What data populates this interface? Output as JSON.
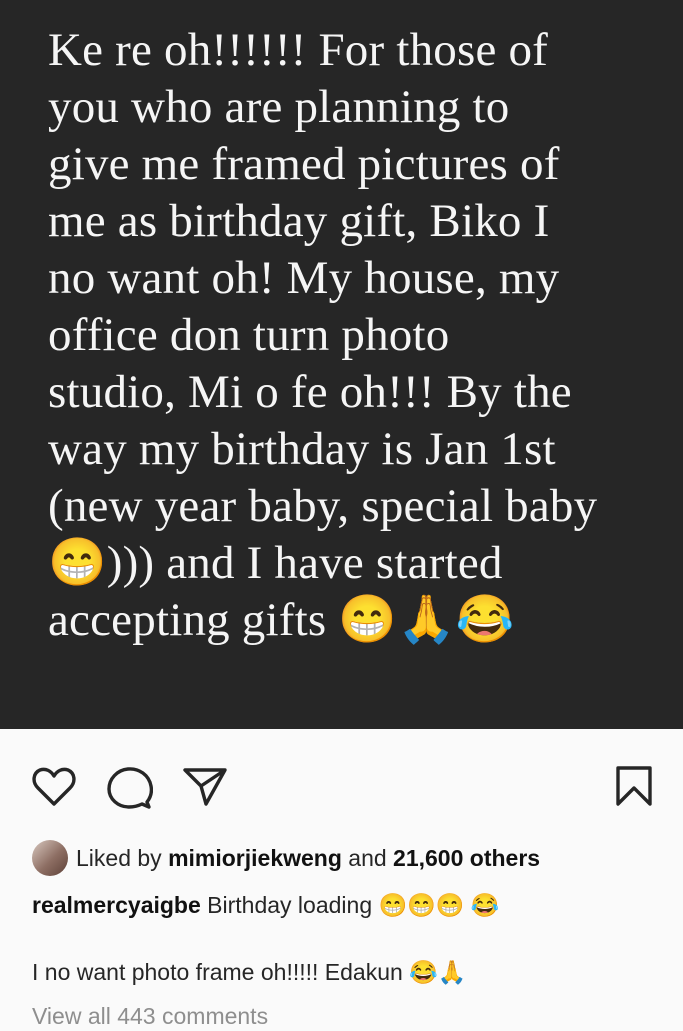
{
  "post": {
    "image_text_lines": [
      "Ke re oh!!!!!! For those of",
      "you who are planning to",
      "give me framed pictures of",
      "me as birthday gift, Biko I",
      "no want oh! My house, my",
      "office don turn photo",
      "studio, Mi o fe oh!!! By the",
      "way my birthday is Jan 1st",
      "(new year baby, special baby",
      "😁))) and I have started",
      "accepting gifts 😁🙏😂"
    ]
  },
  "likes": {
    "prefix": "Liked by ",
    "user": "mimiorjiekweng",
    "middle": " and ",
    "count": "21,600 others"
  },
  "caption": {
    "username": "realmercyaigbe",
    "text": " Birthday loading 😁😁😁 😂"
  },
  "comment": {
    "text": "I no want photo frame oh!!!!! Edakun 😂🙏"
  },
  "comments_link": "View all 443 comments",
  "colors": {
    "image_bg": "#262626",
    "image_text": "#f5f5f5",
    "page_bg": "#fafafa",
    "muted": "#8e8e8e"
  },
  "icons": [
    "heart-icon",
    "comment-icon",
    "share-icon",
    "bookmark-icon"
  ]
}
